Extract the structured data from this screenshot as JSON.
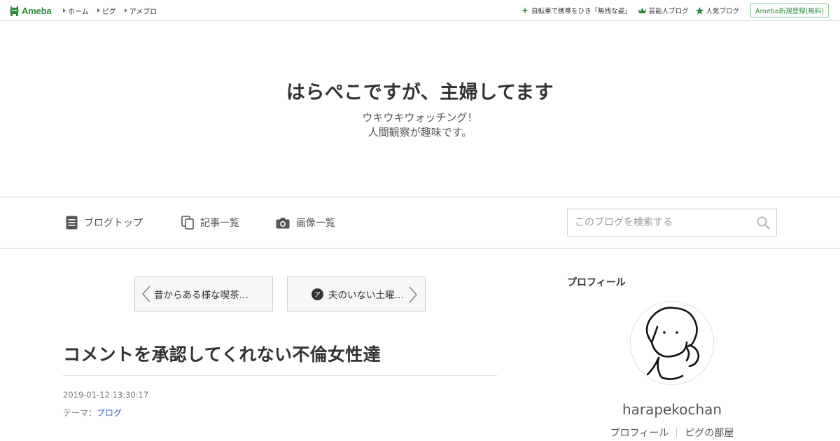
{
  "topbar": {
    "logo_text": "Ameba",
    "nav": [
      {
        "label": "ホーム"
      },
      {
        "label": "ピグ"
      },
      {
        "label": "アメブロ"
      }
    ],
    "trending": "自転車で携帯をひき「無残な姿」",
    "celeb_blog": "芸能人ブログ",
    "popular_blog": "人気ブログ",
    "register": "Ameba新規登録(無料)"
  },
  "header": {
    "title": "はらぺこですが、主婦してます",
    "description_line1": "ウキウキウォッチング！",
    "description_line2": "人間観察が趣味です。"
  },
  "navbar": {
    "blog_top": "ブログトップ",
    "entry_list": "記事一覧",
    "image_list": "画像一覧",
    "search_placeholder": "このブログを検索する"
  },
  "pager": {
    "prev_title": "昔からある様な喫茶…",
    "next_title": "夫のいない土曜…"
  },
  "article": {
    "title": "コメントを承認してくれない不倫女性達",
    "datetime": "2019-01-12 13:30:17",
    "theme_label": "テーマ：",
    "theme_value": "ブログ"
  },
  "sidebar": {
    "heading": "プロフィール",
    "username": "harapekochan",
    "links": [
      "プロフィール",
      "ピグの部屋"
    ]
  },
  "colors": {
    "ameba_green": "#2d8c3c",
    "link_blue": "#3869b8"
  }
}
